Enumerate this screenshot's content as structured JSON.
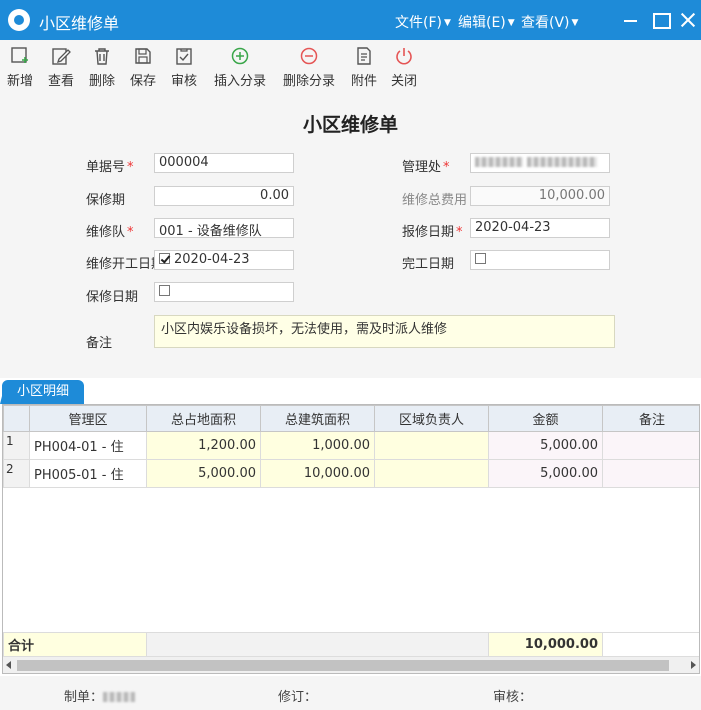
{
  "window": {
    "title": "小区维修单",
    "menus": [
      {
        "label": "文件(F)"
      },
      {
        "label": "编辑(E)"
      },
      {
        "label": "查看(V)"
      }
    ]
  },
  "toolbar": {
    "items": [
      {
        "label": "新增",
        "icon": "add-doc-icon"
      },
      {
        "label": "查看",
        "icon": "edit-icon"
      },
      {
        "label": "删除",
        "icon": "trash-icon"
      },
      {
        "label": "保存",
        "icon": "save-icon"
      },
      {
        "label": "审核",
        "icon": "audit-icon"
      },
      {
        "label": "插入分录",
        "icon": "plus-circle-icon"
      },
      {
        "label": "删除分录",
        "icon": "minus-circle-icon"
      },
      {
        "label": "附件",
        "icon": "attachment-icon"
      },
      {
        "label": "关闭",
        "icon": "power-icon"
      }
    ],
    "colors": {
      "default": "#555555",
      "insert": "#3aa64a",
      "delete": "#e55555",
      "close": "#e55555"
    }
  },
  "form": {
    "doc_title": "小区维修单",
    "bill_no_label": "单据号",
    "bill_no": "000004",
    "office_label": "管理处",
    "warranty_label": "保修期",
    "warranty_value": "0.00",
    "total_cost_label": "维修总费用",
    "total_cost": "10,000.00",
    "team_label": "维修队",
    "team_value": "001 - 设备维修队",
    "report_date_label": "报修日期",
    "report_date": "2020-04-23",
    "start_date_label": "维修开工日期",
    "start_date": "2020-04-23",
    "finish_date_label": "完工日期",
    "warranty_date_label": "保修日期",
    "remark_label": "备注",
    "remark": "小区内娱乐设备损坏，无法使用，需及时派人维修"
  },
  "detail_tab": {
    "label": "小区明细"
  },
  "grid": {
    "columns": [
      "管理区",
      "总占地面积",
      "总建筑面积",
      "区域负责人",
      "金额",
      "备注"
    ],
    "rows": [
      {
        "no": "1",
        "area": "PH004-01 - 住",
        "land": "1,200.00",
        "building": "1,000.00",
        "manager": "",
        "amount": "5,000.00",
        "note": ""
      },
      {
        "no": "2",
        "area": "PH005-01 - 住",
        "land": "5,000.00",
        "building": "10,000.00",
        "manager": "",
        "amount": "5,000.00",
        "note": ""
      }
    ],
    "total_label": "合计",
    "total_amount": "10,000.00"
  },
  "footer": {
    "creator_label": "制单：",
    "reviser_label": "修订：",
    "auditor_label": "审核："
  },
  "colors": {
    "brand": "#1e8bd8",
    "required": "#ee3333"
  }
}
